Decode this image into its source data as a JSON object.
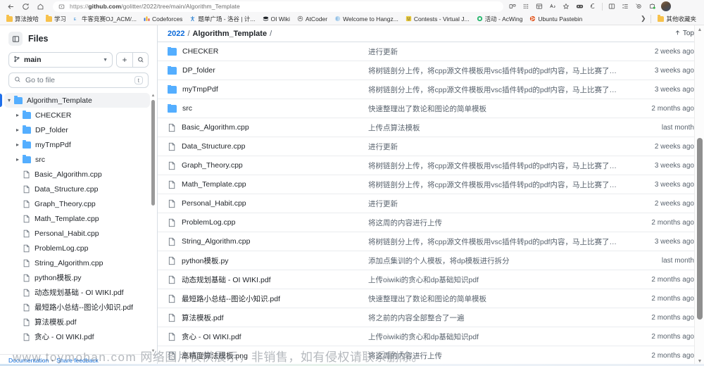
{
  "browser": {
    "url_prefix": "https://",
    "url_domain": "github.com",
    "url_path": "/golitter/2022/tree/main/Algorithm_Template",
    "nav": {
      "back": "back-arrow",
      "reload": "reload",
      "home": "home"
    },
    "toolbar_icons": [
      "split-screen-icon",
      "apps-grid-icon",
      "browser-essentials-icon",
      "read-aloud-icon",
      "favorite-star-icon",
      "collections-icon",
      "copilot-icon",
      "split-view-icon",
      "vertical-tabs-icon",
      "add-extension-icon",
      "extensions-icon"
    ],
    "bookmarks": [
      {
        "label": "算法按哈",
        "icon": "folder-icon"
      },
      {
        "label": "学习",
        "icon": "folder-icon"
      },
      {
        "label": "牛客竞赛OJ_ACM/...",
        "icon": "niuke-icon"
      },
      {
        "label": "Codeforces",
        "icon": "codeforces-icon"
      },
      {
        "label": "题单广场 - 洛谷 | 计...",
        "icon": "luogu-icon"
      },
      {
        "label": "OI Wiki",
        "icon": "oiwiki-icon"
      },
      {
        "label": "AtCoder",
        "icon": "atcoder-icon"
      },
      {
        "label": "Welcome to Hangz...",
        "icon": "hdu-icon"
      },
      {
        "label": "Contests - Virtual J...",
        "icon": "vjudge-icon"
      },
      {
        "label": "活动 - AcWing",
        "icon": "acwing-icon"
      },
      {
        "label": "Ubuntu Pastebin",
        "icon": "ubuntu-icon"
      }
    ],
    "bookmarks_overflow_label": "其他收藏夹",
    "bookmarks_overflow_icon": "chevron-right-icon"
  },
  "sidebar": {
    "title": "Files",
    "panel_icon": "sidebar-toggle-icon",
    "branch": "main",
    "add_button": "+",
    "search_button": "search-icon",
    "go_to_file_placeholder": "Go to file",
    "go_to_file_value": "",
    "go_to_file_kbd": "t",
    "tree": [
      {
        "label": "Algorithm_Template",
        "type": "folder",
        "depth": 0,
        "expanded": true,
        "selected": true
      },
      {
        "label": "CHECKER",
        "type": "folder",
        "depth": 1,
        "expanded": false,
        "selected": false
      },
      {
        "label": "DP_folder",
        "type": "folder",
        "depth": 1,
        "expanded": false,
        "selected": false
      },
      {
        "label": "myTmpPdf",
        "type": "folder",
        "depth": 1,
        "expanded": false,
        "selected": false
      },
      {
        "label": "src",
        "type": "folder",
        "depth": 1,
        "expanded": false,
        "selected": false
      },
      {
        "label": "Basic_Algorithm.cpp",
        "type": "file",
        "depth": 1,
        "expanded": false,
        "selected": false
      },
      {
        "label": "Data_Structure.cpp",
        "type": "file",
        "depth": 1,
        "expanded": false,
        "selected": false
      },
      {
        "label": "Graph_Theory.cpp",
        "type": "file",
        "depth": 1,
        "expanded": false,
        "selected": false
      },
      {
        "label": "Math_Template.cpp",
        "type": "file",
        "depth": 1,
        "expanded": false,
        "selected": false
      },
      {
        "label": "Personal_Habit.cpp",
        "type": "file",
        "depth": 1,
        "expanded": false,
        "selected": false
      },
      {
        "label": "ProblemLog.cpp",
        "type": "file",
        "depth": 1,
        "expanded": false,
        "selected": false
      },
      {
        "label": "String_Algorithm.cpp",
        "type": "file",
        "depth": 1,
        "expanded": false,
        "selected": false
      },
      {
        "label": "python模板.py",
        "type": "file",
        "depth": 1,
        "expanded": false,
        "selected": false
      },
      {
        "label": "动态规划基础 - OI WIKI.pdf",
        "type": "file",
        "depth": 1,
        "expanded": false,
        "selected": false
      },
      {
        "label": "最短路小总结--图论小知识.pdf",
        "type": "file",
        "depth": 1,
        "expanded": false,
        "selected": false
      },
      {
        "label": "算法模板.pdf",
        "type": "file",
        "depth": 1,
        "expanded": false,
        "selected": false
      },
      {
        "label": "贪心 - OI WIKI.pdf",
        "type": "file",
        "depth": 1,
        "expanded": false,
        "selected": false
      }
    ],
    "footer": {
      "documentation": "Documentation",
      "separator": "•",
      "feedback": "Share feedback"
    }
  },
  "main": {
    "breadcrumb": {
      "repo": "2022",
      "sep": "/",
      "folder": "Algorithm_Template",
      "trailing": "/"
    },
    "top_link": {
      "icon": "arrow-up-icon",
      "label": "Top"
    },
    "files": [
      {
        "name": "CHECKER",
        "type": "folder",
        "message": "进行更新",
        "time": "2 weeks ago"
      },
      {
        "name": "DP_folder",
        "type": "folder",
        "message": "将树链剖分上传，将cpp源文件模板用vsc插件转pd的pdf内容，马上比赛了，希望…",
        "time": "3 weeks ago"
      },
      {
        "name": "myTmpPdf",
        "type": "folder",
        "message": "将树链剖分上传，将cpp源文件模板用vsc插件转pd的pdf内容，马上比赛了，希望…",
        "time": "3 weeks ago"
      },
      {
        "name": "src",
        "type": "folder",
        "message": "快速整理出了数论和图论的简单模板",
        "time": "2 months ago"
      },
      {
        "name": "Basic_Algorithm.cpp",
        "type": "file",
        "message": "上传点算法模板",
        "time": "last month"
      },
      {
        "name": "Data_Structure.cpp",
        "type": "file",
        "message": "进行更新",
        "time": "2 weeks ago"
      },
      {
        "name": "Graph_Theory.cpp",
        "type": "file",
        "message": "将树链剖分上传，将cpp源文件模板用vsc插件转pd的pdf内容，马上比赛了，希望…",
        "time": "3 weeks ago"
      },
      {
        "name": "Math_Template.cpp",
        "type": "file",
        "message": "将树链剖分上传，将cpp源文件模板用vsc插件转pd的pdf内容，马上比赛了，希望…",
        "time": "3 weeks ago"
      },
      {
        "name": "Personal_Habit.cpp",
        "type": "file",
        "message": "进行更新",
        "time": "2 weeks ago"
      },
      {
        "name": "ProblemLog.cpp",
        "type": "file",
        "message": "将这周的内容进行上传",
        "time": "2 months ago"
      },
      {
        "name": "String_Algorithm.cpp",
        "type": "file",
        "message": "将树链剖分上传，将cpp源文件模板用vsc插件转pd的pdf内容，马上比赛了，希望…",
        "time": "3 weeks ago"
      },
      {
        "name": "python模板.py",
        "type": "file",
        "message": "添加点集训的个人模板，将dp模板进行拆分",
        "time": "last month"
      },
      {
        "name": "动态规划基础 - OI WIKI.pdf",
        "type": "file",
        "message": "上传oiwiki的贪心和dp基础知识pdf",
        "time": "2 months ago"
      },
      {
        "name": "最短路小总结--图论小知识.pdf",
        "type": "file",
        "message": "快速整理出了数论和图论的简单模板",
        "time": "2 months ago"
      },
      {
        "name": "算法模板.pdf",
        "type": "file",
        "message": "将之前的内容全部整合了一遍",
        "time": "2 months ago"
      },
      {
        "name": "贪心 - OI WIKI.pdf",
        "type": "file",
        "message": "上传oiwiki的贪心和dp基础知识pdf",
        "time": "2 months ago"
      },
      {
        "name": "高精度算法模板.png",
        "type": "file",
        "message": "将这周的内容进行上传",
        "time": "2 months ago"
      }
    ]
  },
  "watermark": {
    "url": "www.toymoban.com",
    "notice": "网络图片仅供展示，非销售，如有侵权请联系删除。"
  },
  "colors": {
    "link": "#0969da",
    "folder": "#54aeff",
    "selection": "#1f6feb",
    "border": "#d8dee4",
    "muted": "#59636e"
  }
}
